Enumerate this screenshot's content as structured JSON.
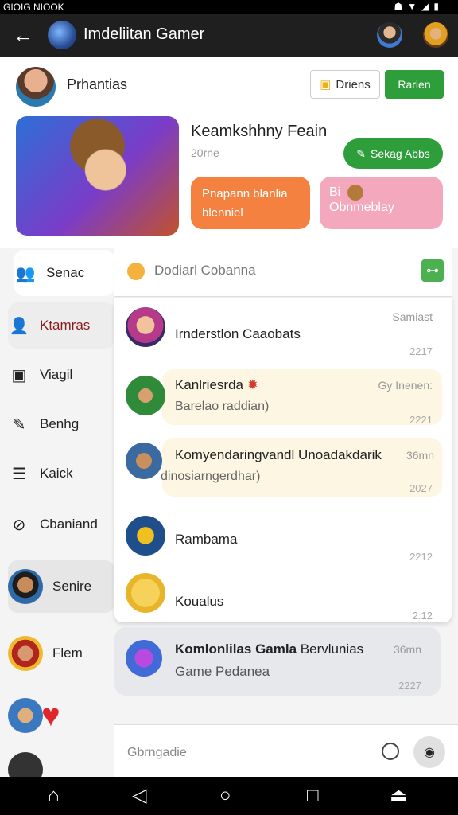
{
  "status_bar": {
    "time": "GIOIG NIOOK",
    "icons": [
      "notification-icon",
      "wifi-icon",
      "signal-icon",
      "battery-icon"
    ]
  },
  "app_bar": {
    "title": "Imdeliitan Gamer"
  },
  "profile": {
    "name": "Prhantias",
    "outline_button": "Driens",
    "green_button": "Rarien"
  },
  "hero": {
    "title": "Keamkshhny Feain",
    "subtitle": "20rne",
    "action_button": "Sekag Abbs",
    "bubble_orange": "Pnapann blanlia blenniel",
    "bubble_pink_prefix": "Bi",
    "bubble_pink": "Obnmeblay"
  },
  "sidebar": {
    "items": [
      {
        "label": "Senac",
        "icon": "users-icon"
      },
      {
        "label": "Ktamras",
        "icon": "person-icon"
      },
      {
        "label": "Viagil",
        "icon": "camera-icon"
      },
      {
        "label": "Benhg",
        "icon": "edit-icon"
      },
      {
        "label": "Kaick",
        "icon": "message-icon"
      },
      {
        "label": "Cbaniand",
        "icon": "compass-icon"
      },
      {
        "label": "Senire",
        "icon": "avatar"
      },
      {
        "label": "Flem",
        "icon": "avatar"
      },
      {
        "label": "",
        "icon": "heart-icon"
      }
    ]
  },
  "search": {
    "placeholder": "Dodiarl Cobanna"
  },
  "chats": [
    {
      "title": "Irnderstlon Caaobats",
      "subtitle": "",
      "meta": "Samiast",
      "time": "2217"
    },
    {
      "title": "Kanlriesrda",
      "subtitle": "Barelao raddian)",
      "meta": "Gy Inenen:",
      "time": "2221"
    },
    {
      "title": "Komyendaringvandl Unoadakdarik",
      "subtitle": "dinosiarngerdhar)",
      "meta": "36mn",
      "time": "2027"
    },
    {
      "title": "Rambama",
      "subtitle": "",
      "meta": "",
      "time": "2212"
    },
    {
      "title": "Koualus",
      "subtitle": "",
      "meta": "",
      "time": "2:12"
    },
    {
      "title": "Komlonlilas Gamla",
      "title_extra": "Bervlunias",
      "subtitle": "Game Pedanea",
      "meta": "36mn",
      "time": "2227"
    }
  ],
  "composer": {
    "placeholder": "Gbrngadie"
  },
  "colors": {
    "accent_green": "#2e9e3a",
    "bubble_orange": "#f4813f",
    "bubble_pink": "#f3a8bd",
    "highlight": "#fdf6e2"
  }
}
